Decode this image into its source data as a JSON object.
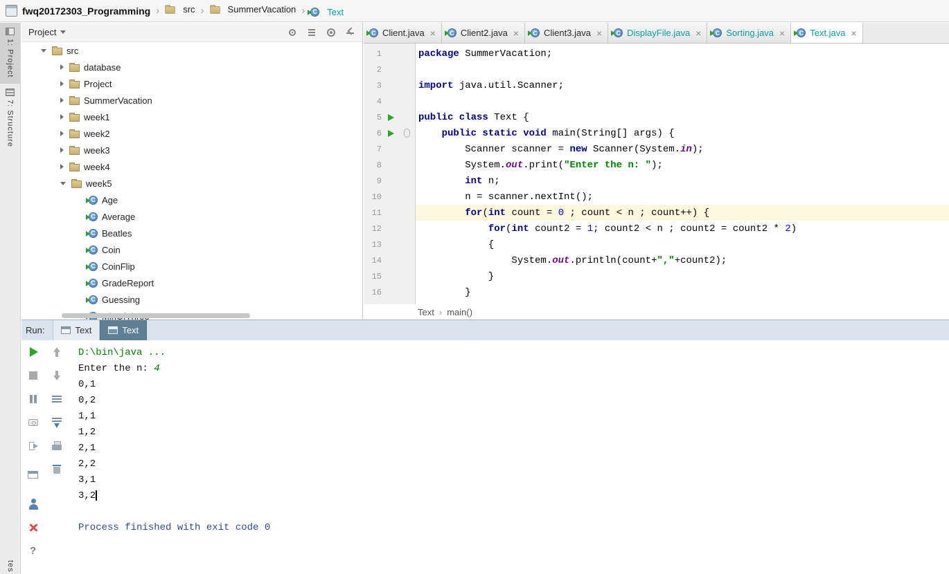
{
  "colors": {
    "teal_filename": "#0a9e9e",
    "keyword": "#000080",
    "string": "#008000",
    "number": "#0000ff",
    "static_field": "#660e7a",
    "caret_row": "#fcf8de",
    "run_tab_selected": "#5f7f94",
    "run_header_bg": "#d8e3ee",
    "console_command": "#008000",
    "console_system": "#32498e",
    "run_arrow_green": "#2ca32c",
    "close_red": "#d4504f"
  },
  "top_bar": {
    "project": "fwq20172303_Programming",
    "crumbs": [
      {
        "label": "src",
        "icon": "folder"
      },
      {
        "label": "SummerVacation",
        "icon": "folder"
      },
      {
        "label": "Text",
        "icon": "class"
      }
    ]
  },
  "tool_stripe": {
    "items": [
      {
        "label": "1: Project",
        "active": true
      },
      {
        "label": "7: Structure",
        "active": false
      }
    ],
    "bottom_partial": "tes"
  },
  "project_panel": {
    "title": "Project",
    "header_icons": [
      "locate",
      "collapse-all",
      "settings",
      "hide"
    ],
    "tree": [
      {
        "label": "src",
        "level": 0,
        "type": "folder",
        "state": "expanded"
      },
      {
        "label": "database",
        "level": 1,
        "type": "folder",
        "state": "collapsed"
      },
      {
        "label": "Project",
        "level": 1,
        "type": "folder",
        "state": "collapsed"
      },
      {
        "label": "SummerVacation",
        "level": 1,
        "type": "folder",
        "state": "collapsed"
      },
      {
        "label": "week1",
        "level": 1,
        "type": "folder",
        "state": "collapsed"
      },
      {
        "label": "week2",
        "level": 1,
        "type": "folder",
        "state": "collapsed"
      },
      {
        "label": "week3",
        "level": 1,
        "type": "folder",
        "state": "collapsed"
      },
      {
        "label": "week4",
        "level": 1,
        "type": "folder",
        "state": "collapsed"
      },
      {
        "label": "week5",
        "level": 1,
        "type": "folder",
        "state": "expanded"
      },
      {
        "label": "Age",
        "level": 2,
        "type": "class",
        "state": "leaf"
      },
      {
        "label": "Average",
        "level": 2,
        "type": "class",
        "state": "leaf"
      },
      {
        "label": "Beatles",
        "level": 2,
        "type": "class",
        "state": "leaf"
      },
      {
        "label": "Coin",
        "level": 2,
        "type": "class",
        "state": "leaf"
      },
      {
        "label": "CoinFlip",
        "level": 2,
        "type": "class",
        "state": "leaf"
      },
      {
        "label": "GradeReport",
        "level": 2,
        "type": "class",
        "state": "leaf"
      },
      {
        "label": "Guessing",
        "level": 2,
        "type": "class",
        "state": "leaf"
      },
      {
        "label": "MinOfThree",
        "level": 2,
        "type": "class",
        "state": "leaf"
      }
    ]
  },
  "editor": {
    "tabs": [
      {
        "label": "Client.java",
        "teal": false,
        "active": false
      },
      {
        "label": "Client2.java",
        "teal": false,
        "active": false
      },
      {
        "label": "Client3.java",
        "teal": false,
        "active": false
      },
      {
        "label": "DisplayFile.java",
        "teal": true,
        "active": false
      },
      {
        "label": "Sorting.java",
        "teal": true,
        "active": false
      },
      {
        "label": "Text.java",
        "teal": true,
        "active": true
      }
    ],
    "breadcrumbs": [
      "Text",
      "main()"
    ],
    "lines": [
      {
        "num": 1,
        "seg": [
          [
            "kw",
            "package"
          ],
          [
            "pl",
            " SummerVacation;"
          ]
        ]
      },
      {
        "num": 2,
        "seg": []
      },
      {
        "num": 3,
        "seg": [
          [
            "kw",
            "import"
          ],
          [
            "pl",
            " java.util.Scanner;"
          ]
        ]
      },
      {
        "num": 4,
        "seg": []
      },
      {
        "num": 5,
        "run": true,
        "seg": [
          [
            "kw",
            "public class"
          ],
          [
            "pl",
            " Text {"
          ]
        ]
      },
      {
        "num": 6,
        "run": true,
        "pill": true,
        "seg": [
          [
            "pl",
            "    "
          ],
          [
            "kw",
            "public static void"
          ],
          [
            "pl",
            " main(String[] args) {"
          ]
        ]
      },
      {
        "num": 7,
        "seg": [
          [
            "pl",
            "        Scanner scanner = "
          ],
          [
            "kw",
            "new"
          ],
          [
            "pl",
            " Scanner(System."
          ],
          [
            "fld",
            "in"
          ],
          [
            "pl",
            ");"
          ]
        ]
      },
      {
        "num": 8,
        "seg": [
          [
            "pl",
            "        System."
          ],
          [
            "fld",
            "out"
          ],
          [
            "pl",
            ".print("
          ],
          [
            "str",
            "\"Enter the n: \""
          ],
          [
            "pl",
            ");"
          ]
        ]
      },
      {
        "num": 9,
        "seg": [
          [
            "pl",
            "        "
          ],
          [
            "kw",
            "int"
          ],
          [
            "pl",
            " n;"
          ]
        ]
      },
      {
        "num": 10,
        "seg": [
          [
            "pl",
            "        n = scanner.nextInt();"
          ]
        ]
      },
      {
        "num": 11,
        "current": true,
        "seg": [
          [
            "pl",
            "        "
          ],
          [
            "kw",
            "for"
          ],
          [
            "pl",
            "("
          ],
          [
            "kw",
            "int"
          ],
          [
            "pl",
            " count = "
          ],
          [
            "num",
            "0"
          ],
          [
            "pl",
            " ; count < n ; count++) {"
          ]
        ]
      },
      {
        "num": 12,
        "seg": [
          [
            "pl",
            "            "
          ],
          [
            "kw",
            "for"
          ],
          [
            "pl",
            "("
          ],
          [
            "kw",
            "int"
          ],
          [
            "pl",
            " count2 = "
          ],
          [
            "num",
            "1"
          ],
          [
            "pl",
            "; count2 < n ; count2 = count2 * "
          ],
          [
            "num",
            "2"
          ],
          [
            "pl",
            ")"
          ]
        ]
      },
      {
        "num": 13,
        "seg": [
          [
            "pl",
            "            {"
          ]
        ]
      },
      {
        "num": 14,
        "seg": [
          [
            "pl",
            "                System."
          ],
          [
            "fld",
            "out"
          ],
          [
            "pl",
            ".println(count+"
          ],
          [
            "str",
            "\",\""
          ],
          [
            "pl",
            "+count2);"
          ]
        ]
      },
      {
        "num": 15,
        "seg": [
          [
            "pl",
            "            }"
          ]
        ]
      },
      {
        "num": 16,
        "seg": [
          [
            "pl",
            "        }"
          ]
        ]
      }
    ]
  },
  "run_panel": {
    "label": "Run:",
    "tabs": [
      {
        "label": "Text",
        "active": false
      },
      {
        "label": "Text",
        "active": true
      }
    ],
    "toolbar_left": [
      "rerun",
      "stop",
      "pause",
      "dump-threads",
      "exit",
      "show-console",
      "attach-debugger",
      "close",
      "help"
    ],
    "toolbar_right": [
      "up-stack-trace",
      "down-stack-trace",
      "soft-wrap",
      "scroll-to-end",
      "print",
      "clear-all"
    ],
    "console": [
      {
        "seg": [
          [
            "cmd",
            "D:\\bin\\java ..."
          ]
        ]
      },
      {
        "seg": [
          [
            "out",
            "Enter the n: "
          ],
          [
            "inp",
            "4"
          ]
        ]
      },
      {
        "seg": [
          [
            "out",
            "0,1"
          ]
        ]
      },
      {
        "seg": [
          [
            "out",
            "0,2"
          ]
        ]
      },
      {
        "seg": [
          [
            "out",
            "1,1"
          ]
        ]
      },
      {
        "seg": [
          [
            "out",
            "1,2"
          ]
        ]
      },
      {
        "seg": [
          [
            "out",
            "2,1"
          ]
        ]
      },
      {
        "seg": [
          [
            "out",
            "2,2"
          ]
        ]
      },
      {
        "seg": [
          [
            "out",
            "3,1"
          ]
        ]
      },
      {
        "seg": [
          [
            "out",
            "3,2"
          ]
        ],
        "caret": true
      },
      {
        "seg": []
      },
      {
        "seg": [
          [
            "sys",
            "Process finished with exit code 0"
          ]
        ]
      }
    ]
  }
}
